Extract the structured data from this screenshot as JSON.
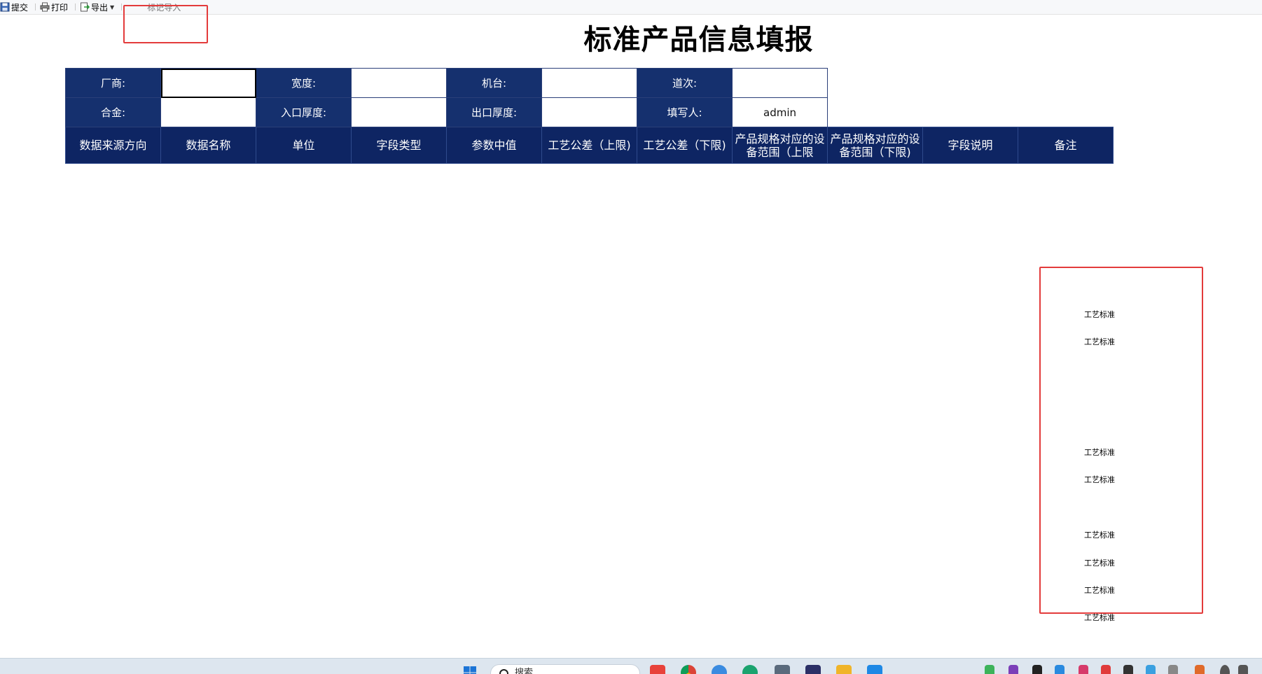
{
  "toolbar": {
    "submit_label": "提交",
    "print_label": "打印",
    "export_label": "导出",
    "mark_import_label": "标记导入"
  },
  "title": "标准产品信息填报",
  "form": {
    "row1": {
      "vendor_label": "厂商:",
      "vendor_value": "",
      "width_label": "宽度:",
      "width_value": "",
      "machine_label": "机台:",
      "machine_value": "",
      "pass_label": "道次:",
      "pass_value": ""
    },
    "row2": {
      "alloy_label": "合金:",
      "alloy_value": "",
      "entry_thickness_label": "入口厚度:",
      "entry_thickness_value": "",
      "exit_thickness_label": "出口厚度:",
      "exit_thickness_value": "",
      "filler_label": "填写人:",
      "filler_value": "admin"
    }
  },
  "table": {
    "headers": [
      "数据来源方向",
      "数据名称",
      "单位",
      "字段类型",
      "参数中值",
      "工艺公差（上限)",
      "工艺公差（下限)",
      "产品规格对应的设备范围（上限",
      "产品规格对应的设备范围（下限)",
      "字段说明",
      "备注"
    ]
  },
  "side_labels": [
    "工艺标准",
    "工艺标准",
    "工艺标准",
    "工艺标准",
    "工艺标准",
    "工艺标准",
    "工艺标准",
    "工艺标准"
  ],
  "taskbar": {
    "search_placeholder": "搜索"
  },
  "colors": {
    "header_navy": "#0e2563",
    "label_navy": "#15306e",
    "highlight_red": "#e33b3b"
  }
}
